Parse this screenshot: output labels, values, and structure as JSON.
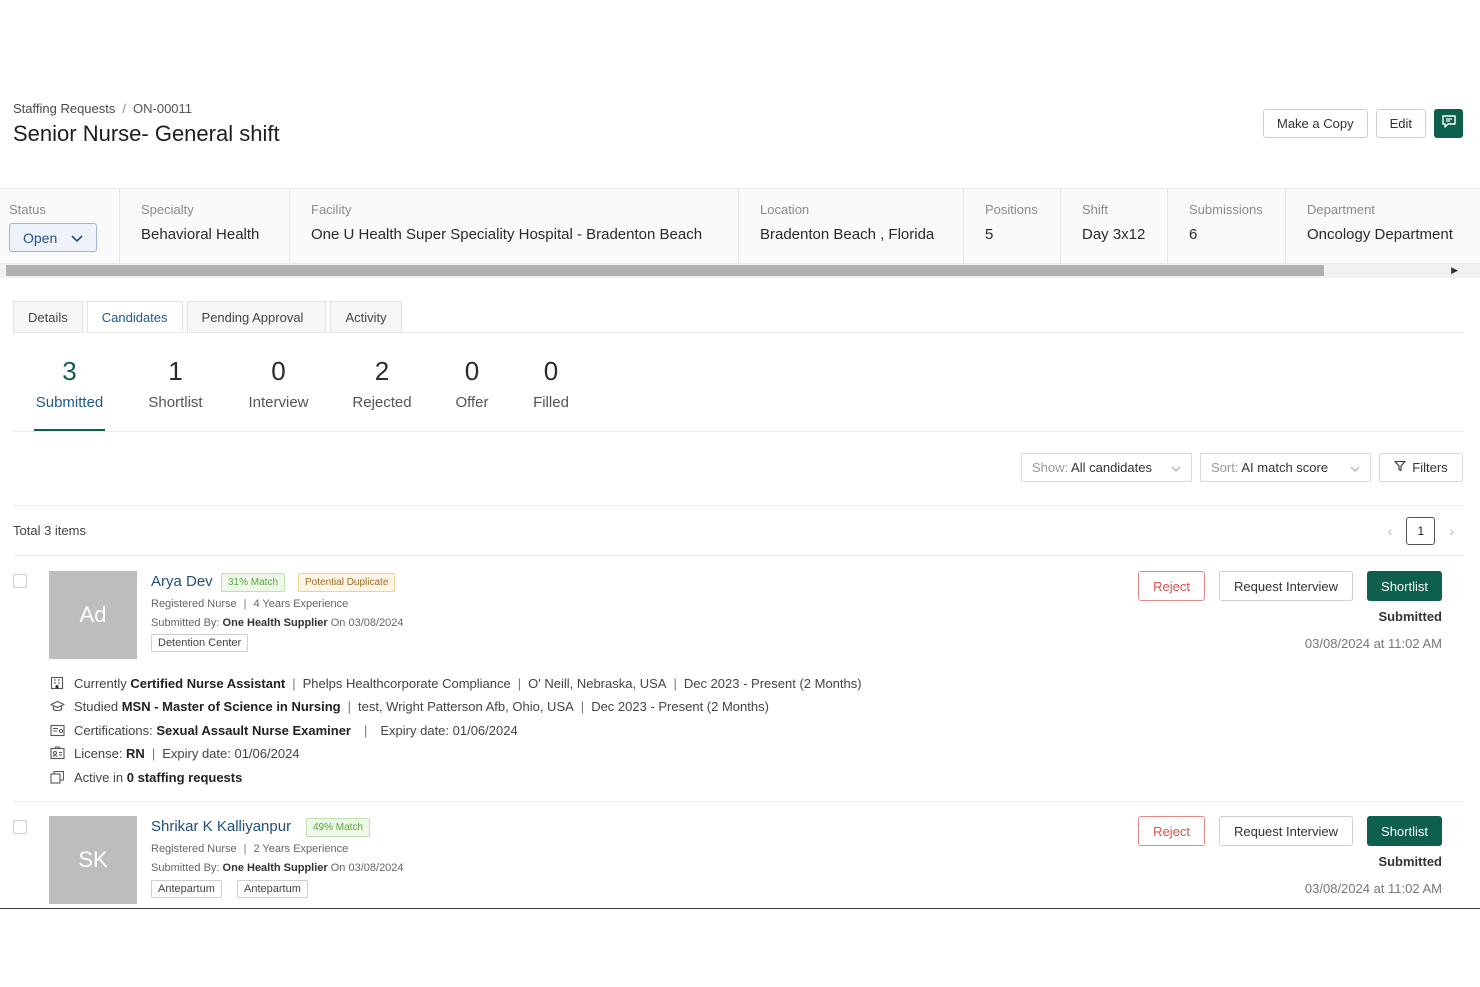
{
  "breadcrumb": {
    "parent": "Staffing Requests",
    "separator": "/",
    "current": "ON-00011"
  },
  "page_title": "Senior Nurse- General shift",
  "header_actions": {
    "copy": "Make a Copy",
    "edit": "Edit",
    "chat_icon": "chat-icon"
  },
  "info": {
    "status": {
      "label": "Status",
      "value": "Open"
    },
    "specialty": {
      "label": "Specialty",
      "value": "Behavioral Health"
    },
    "facility": {
      "label": "Facility",
      "value": "One U Health Super Speciality Hospital - Bradenton Beach"
    },
    "location": {
      "label": "Location",
      "value": "Bradenton Beach , Florida"
    },
    "positions": {
      "label": "Positions",
      "value": "5"
    },
    "shift": {
      "label": "Shift",
      "value": "Day 3x12"
    },
    "submissions": {
      "label": "Submissions",
      "value": "6"
    },
    "department": {
      "label": "Department",
      "value": "Oncology Department"
    }
  },
  "tabs": [
    "Details",
    "Candidates",
    "Pending Approval",
    "Activity"
  ],
  "active_tab": "Candidates",
  "stats": [
    {
      "count": "3",
      "label": "Submitted"
    },
    {
      "count": "1",
      "label": "Shortlist"
    },
    {
      "count": "0",
      "label": "Interview"
    },
    {
      "count": "2",
      "label": "Rejected"
    },
    {
      "count": "0",
      "label": "Offer"
    },
    {
      "count": "0",
      "label": "Filled"
    }
  ],
  "filters": {
    "show_prefix": "Show:",
    "show_value": "All candidates",
    "sort_prefix": "Sort:",
    "sort_value": "AI match score",
    "filters_label": "Filters"
  },
  "total_items": "Total 3 items",
  "pagination": {
    "current_page": "1"
  },
  "candidates": [
    {
      "initials": "Ad",
      "name": "Arya Dev",
      "match": "31% Match",
      "duplicate": "Potential Duplicate",
      "role": "Registered Nurse",
      "experience": "4 Years Experience",
      "submitted_by_label": "Submitted By:",
      "submitted_by": "One Health Supplier",
      "submitted_on": "On 03/08/2024",
      "tags": [
        "Detention Center"
      ],
      "actions": {
        "reject": "Reject",
        "request": "Request Interview",
        "shortlist": "Shortlist"
      },
      "status": "Submitted",
      "date": "03/08/2024 at 11:02 AM",
      "details": {
        "work_prefix": "Currently",
        "work_title": "Certified Nurse Assistant",
        "work_org": "Phelps Healthcorporate Compliance",
        "work_place": "O' Neill, Nebraska, USA",
        "work_dates": "Dec 2023 - Present (2 Months)",
        "edu_prefix": "Studied",
        "edu_degree": "MSN - Master of Science in Nursing",
        "edu_school": "test, Wright Patterson Afb, Ohio, USA",
        "edu_dates": "Dec 2023 - Present (2 Months)",
        "cert_label": "Certifications:",
        "cert_value": "Sexual Assault Nurse Examiner",
        "cert_expiry": "Expiry date: 01/06/2024",
        "license_label": "License:",
        "license_value": "RN",
        "license_expiry": "Expiry date: 01/06/2024",
        "active_prefix": "Active in",
        "active_value": "0 staffing requests"
      }
    },
    {
      "initials": "SK",
      "name": "Shrikar K Kalliyanpur",
      "match": "49% Match",
      "role": "Registered Nurse",
      "experience": "2 Years Experience",
      "submitted_by_label": "Submitted By:",
      "submitted_by": "One Health Supplier",
      "submitted_on": "On 03/08/2024",
      "tags": [
        "Antepartum",
        "Antepartum"
      ],
      "actions": {
        "reject": "Reject",
        "request": "Request Interview",
        "shortlist": "Shortlist"
      },
      "status": "Submitted",
      "date": "03/08/2024 at 11:02 AM"
    }
  ],
  "colors": {
    "brand": "#0f5f4e",
    "link": "#1e4f7e",
    "reject": "#d9534f",
    "match_bg": "#eef8e8",
    "duplicate_bg": "#fff6e6"
  }
}
